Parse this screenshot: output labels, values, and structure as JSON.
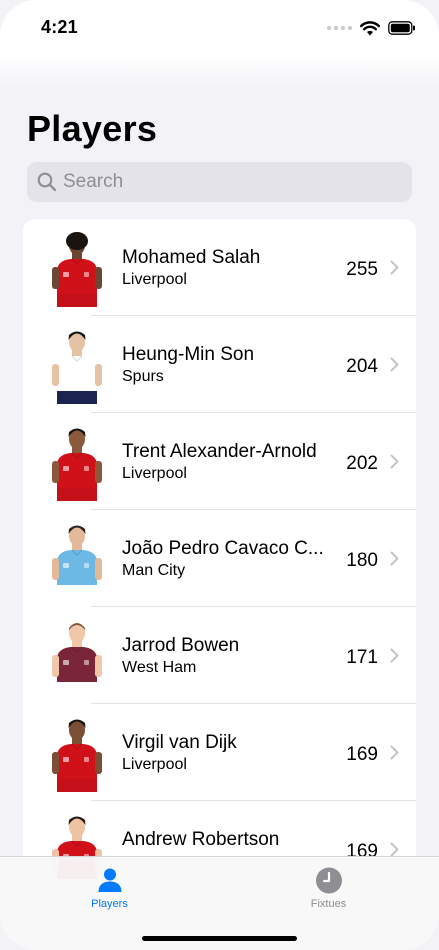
{
  "status_bar": {
    "time": "4:21"
  },
  "page": {
    "title": "Players"
  },
  "search": {
    "placeholder": "Search",
    "value": ""
  },
  "players": [
    {
      "name": "Mohamed Salah",
      "team": "Liverpool",
      "points": "255",
      "shirt": "#d0111a",
      "shorts": "#c5101a",
      "skin": "#6b4632",
      "hair": "#1a1410",
      "hair_style": "afro"
    },
    {
      "name": "Heung-Min Son",
      "team": "Spurs",
      "points": "204",
      "shirt": "#ffffff",
      "shorts": "#1b2350",
      "skin": "#e6c2a4",
      "hair": "#141414",
      "hair_style": "short"
    },
    {
      "name": "Trent Alexander-Arnold",
      "team": "Liverpool",
      "points": "202",
      "shirt": "#d0111a",
      "shorts": "#c5101a",
      "skin": "#8b5a3c",
      "hair": "#1a1410",
      "hair_style": "short"
    },
    {
      "name": "João Pedro Cavaco C...",
      "team": "Man City",
      "points": "180",
      "shirt": "#6cb9e6",
      "shorts": "#ffffff",
      "skin": "#e3b99a",
      "hair": "#2a2420",
      "hair_style": "short"
    },
    {
      "name": "Jarrod Bowen",
      "team": "West Ham",
      "points": "171",
      "shirt": "#7a2638",
      "shorts": "#ffffff",
      "skin": "#f0c7a8",
      "hair": "#7a5a3a",
      "hair_style": "buzz"
    },
    {
      "name": "Virgil van Dijk",
      "team": "Liverpool",
      "points": "169",
      "shirt": "#d0111a",
      "shorts": "#c5101a",
      "skin": "#7b4e36",
      "hair": "#1a1410",
      "hair_style": "short"
    },
    {
      "name": "Andrew Robertson",
      "team": "",
      "points": "169",
      "shirt": "#d0111a",
      "shorts": "#c5101a",
      "skin": "#eec3a3",
      "hair": "#2a1c12",
      "hair_style": "short"
    }
  ],
  "tabs": [
    {
      "label": "Players",
      "icon": "person-icon",
      "selected": true
    },
    {
      "label": "Fixtues",
      "icon": "clock-icon",
      "selected": false
    }
  ],
  "colors": {
    "accent": "#007aff",
    "inactive": "#8e8e93",
    "chevron": "#c4c4c7"
  }
}
